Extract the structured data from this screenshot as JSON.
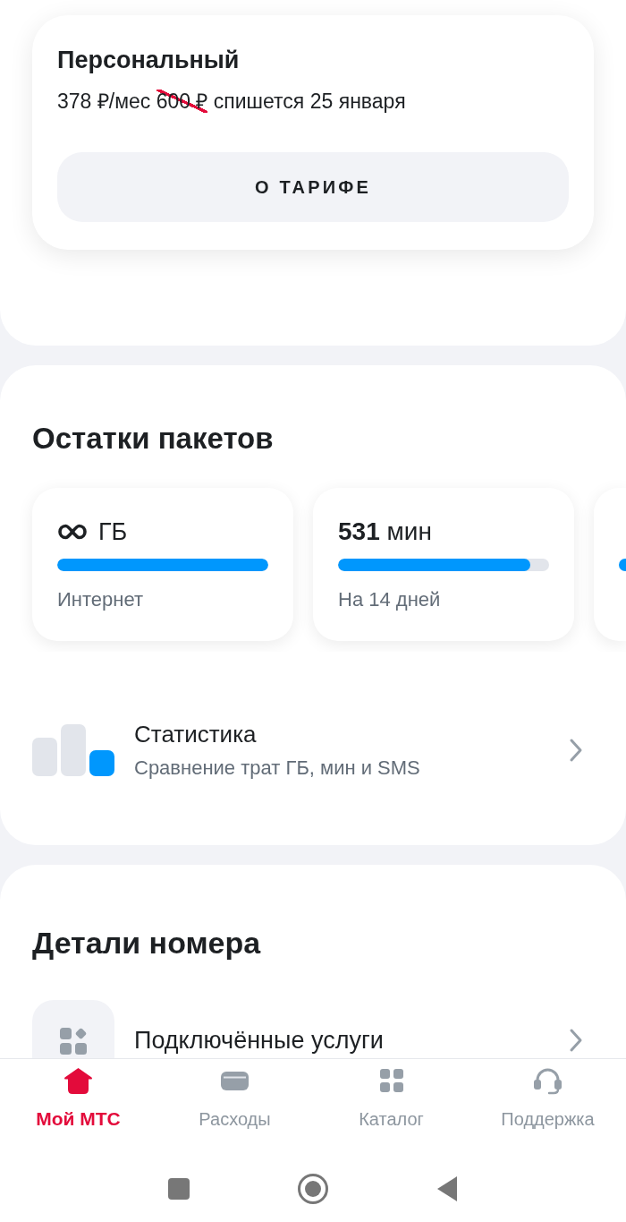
{
  "tariff": {
    "name": "Персональный",
    "price": "378 ₽/мес",
    "old_price": "600 ₽",
    "charge": "спишется 25 января",
    "button": "О ТАРИФЕ"
  },
  "packages": {
    "title": "Остатки пакетов",
    "items": [
      {
        "kind": "unlimited",
        "unit": "ГБ",
        "level": 1,
        "caption": "Интернет"
      },
      {
        "kind": "amount",
        "amount": "531",
        "unit": "мин",
        "level": 0.91,
        "caption": "На 14 дней"
      }
    ]
  },
  "statistics": {
    "title": "Статистика",
    "subtitle": "Сравнение трат ГБ, мин и SMS"
  },
  "number_details": {
    "title": "Детали номера",
    "items": [
      {
        "label": "Подключённые услуги"
      }
    ]
  },
  "bottom_nav": {
    "items": [
      {
        "label": "Мой МТС",
        "selected": true
      },
      {
        "label": "Расходы",
        "selected": false
      },
      {
        "label": "Каталог",
        "selected": false
      },
      {
        "label": "Поддержка",
        "selected": false
      }
    ]
  }
}
